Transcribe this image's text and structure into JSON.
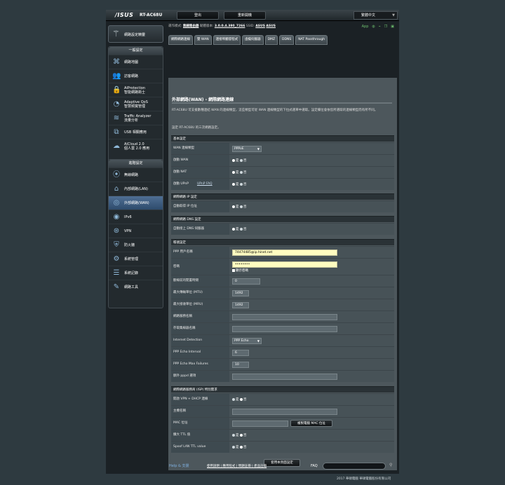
{
  "header": {
    "logo": "/ISUS",
    "model": "RT-AC68U",
    "logout": "登出",
    "reboot": "重新開機",
    "language": "繁體中文"
  },
  "status": {
    "mode_label": "運作模式:",
    "mode_value": "無線路由器",
    "firmware_label": "韌體版本:",
    "firmware_value": "3.0.0.4.380_7266",
    "ssid_label": "SSID:",
    "ssid_values": [
      "ASUS",
      "ASUS"
    ],
    "app_label": "App"
  },
  "sidebar": {
    "qis_label": "網路設定精靈",
    "general_title": "一般設定",
    "general_items": [
      {
        "icon": "network-map-icon",
        "label": "網路地圖"
      },
      {
        "icon": "guest-network-icon",
        "label": "訪客網路"
      },
      {
        "icon": "aiprotection-icon",
        "label": "AiProtection\n智能網路衛士"
      },
      {
        "icon": "adaptive-qos-icon",
        "label": "Adaptive QoS\n智慧頻寬管理"
      },
      {
        "icon": "traffic-analyzer-icon",
        "label": "Traffic Analyzer\n流量分析"
      },
      {
        "icon": "usb-app-icon",
        "label": "USB 相關應用"
      },
      {
        "icon": "aicloud-icon",
        "label": "AiCloud 2.0\n個人雲 2.0 應用"
      }
    ],
    "advanced_title": "進階設定",
    "advanced_items": [
      {
        "icon": "wireless-icon",
        "label": "無線網路"
      },
      {
        "icon": "lan-icon",
        "label": "內部網路(LAN)"
      },
      {
        "icon": "wan-icon",
        "label": "外部網路(WAN)"
      },
      {
        "icon": "ipv6-icon",
        "label": "IPv6"
      },
      {
        "icon": "vpn-icon",
        "label": "VPN"
      },
      {
        "icon": "firewall-icon",
        "label": "防火牆"
      },
      {
        "icon": "admin-icon",
        "label": "系統管理"
      },
      {
        "icon": "syslog-icon",
        "label": "系統記錄"
      },
      {
        "icon": "tools-icon",
        "label": "網路工具"
      }
    ],
    "active_index": 2
  },
  "tabs": [
    "網際網路連線",
    "雙 WAN",
    "連接埠觸發程式",
    "虛擬伺服器",
    "DMZ",
    "DDNS",
    "NAT Passthrough"
  ],
  "page": {
    "title": "外部網路(WAN) - 網際網路連線",
    "description": "RT-AC68U 可支援數種連結 WAN 的連線類型，這些類型可從 WAN 連線類型的下拉式選單中選取。設定欄位會依您所選取的連線類型而有所不同。",
    "subdesc": "設定 RT-AC68U 的三次網路設定。"
  },
  "sections": {
    "basic": "基本設定",
    "ip": "網際網路 IP 設定",
    "dns": "網際網路 DNS 設定",
    "account": "帳號設定",
    "isp": "網際網路服務商 (ISP) 特別需求"
  },
  "fields": {
    "wan_type_label": "WAN 連線類型",
    "wan_type_value": "PPPoE",
    "enable_wan_label": "啟動 WAN",
    "enable_nat_label": "啟動 NAT",
    "enable_upnp_label": "啟動 UPnP",
    "upnp_faq": "UPnP FAQ",
    "auto_ip_label": "自動取得 IP 位址",
    "auto_dns_label": "自動接上 DNS 伺服器",
    "ppp_user_label": "PPP 用戶名稱",
    "ppp_user_value": "74474485@ip.hinet.net",
    "password_label": "密碼",
    "password_value": "••••••••",
    "show_password": "顯示密碼",
    "idle_label": "斷線前的閒置時間",
    "idle_value": "0",
    "mtu_label": "最大傳輸單位 (MTU)",
    "mtu_value": "1492",
    "mru_label": "最大接收單位 (MRU)",
    "mru_value": "1492",
    "service_name_label": "網路服務名稱",
    "service_name_value": "",
    "ac_name_label": "存取集線器名稱",
    "ac_name_value": "",
    "internet_detection_label": "Internet Detection",
    "internet_detection_value": "PPP Echo",
    "echo_interval_label": "PPP Echo Interval",
    "echo_interval_value": "6",
    "echo_failures_label": "PPP Echo Max Failures",
    "echo_failures_value": "10",
    "pppd_label": "額外 pppd 選項",
    "pppd_value": "",
    "vpn_dhcp_label": "開啟 VPN + DHCP 連線",
    "host_name_label": "主機名稱",
    "host_name_value": "",
    "mac_label": "MAC 位址",
    "mac_value": "",
    "mac_button": "複製電腦 MAC 位址",
    "ttl_label": "擴大 TTL 值",
    "spoof_ttl_label": "Spoof LAN TTL value",
    "yes": "是",
    "no": "否"
  },
  "apply_button": "套用本頁面設定",
  "footer": {
    "help": "Help & 支援",
    "links": "使用說明 | 應用程式 | 問題註冊 | 產品註冊",
    "faq": "FAQ",
    "copyright": "2017 華碩電腦 華碩電腦股份有限公司"
  }
}
